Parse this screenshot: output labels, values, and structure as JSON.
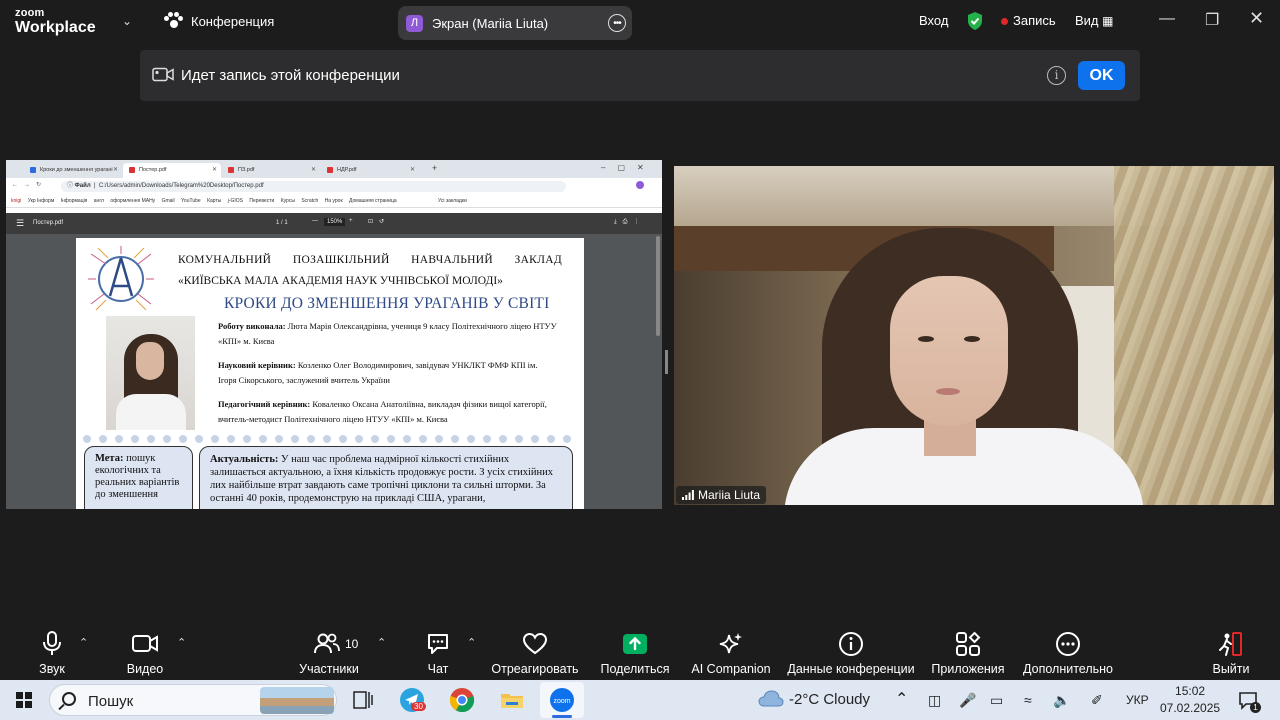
{
  "app": {
    "logo_line1": "zoom",
    "logo_line2": "Workplace",
    "conference_label": "Конференция",
    "share_pill": {
      "avatar_letter": "Л",
      "label": "Экран (Mariia Liuta)"
    },
    "signin_label": "Вход",
    "record_label": "Запись",
    "view_label": "Вид"
  },
  "banner": {
    "text": "Идет запись этой конференции",
    "ok_label": "OK"
  },
  "shared_screen": {
    "tabs": [
      "Кроки до зменшення урагані",
      "Постер.pdf",
      "ПЗ.pdf",
      "НДР.pdf"
    ],
    "address": "C:/Users/admin/Downloads/Telegram%20Desktop/Постер.pdf",
    "address_prefix": "Файл",
    "bookmarks": [
      "knigi",
      "Укр Інформ",
      "Інформація",
      "англ",
      "оформлення МАНу",
      "Gmail",
      "YouTube",
      "Карты",
      "j-GIOS",
      "Перевести",
      "Курсы",
      "Scratch",
      "На урок",
      "Домашняя страница",
      "Усі закладки"
    ],
    "pdf_name": "Постер.pdf",
    "pdf_page": "1 / 1",
    "pdf_zoom": "150%",
    "poster": {
      "header1": "КОМУНАЛЬНИЙ ПОЗАШКІЛЬНИЙ НАВЧАЛЬНИЙ ЗАКЛАД",
      "header2": "«КИЇВСЬКА МАЛА АКАДЕМІЯ НАУК УЧНІВСЬКОЇ МОЛОДІ»",
      "title": "КРОКИ ДО ЗМЕНШЕННЯ УРАГАНІВ У СВІТІ",
      "author_label": "Роботу виконала:",
      "author_text": "Люта Марія Олександрівна, учениця 9 класу Політехнічного ліцею НТУУ «КПІ» м. Києва",
      "sci_label": "Науковий керівник:",
      "sci_text": "Козленко Олег Володимирович, завідувач УНКЛКТ ФМФ КПІ ім. Ігоря Сікорського, заслужений вчитель України",
      "ped_label": "Педагогічний керівник:",
      "ped_text": "Коваленко Оксана Анатоліївна, викладач фізики вищої категорії, вчитель-методист Політехнічного ліцею НТУУ «КПІ» м. Києва",
      "goal_label": "Мета:",
      "goal_text": "пошук екологічних та реальних варіантів до зменшення",
      "rel_label": "Актуальність:",
      "rel_text": "У наш час проблема надмірної кількості стихійних залишається актуальною, а їхня кількість продовжує рости. З усіх стихійних лих найбільше втрат завдають саме тропічні циклони та сильні шторми. За останні 40 років, продемонструю на прикладі США, урагани,"
    }
  },
  "video": {
    "participant_name": "Mariia Liuta"
  },
  "toolbar": {
    "audio": "Звук",
    "video": "Видео",
    "participants": "Участники",
    "participants_count": "10",
    "chat": "Чат",
    "react": "Отреагировать",
    "share": "Поделиться",
    "ai": "AI Companion",
    "info": "Данные конференции",
    "apps": "Приложения",
    "more": "Дополнительно",
    "leave": "Выйти"
  },
  "taskbar": {
    "search_placeholder": "Пошук",
    "telegram_badge": "30",
    "weather": "-2°C  Cloudy",
    "language": "УКР",
    "time": "15:02",
    "date": "07.02.2025",
    "notif_count": "1"
  },
  "colors": {
    "accent": "#0e72ed",
    "share_green": "#00b060",
    "record_red": "#e02828",
    "poster_title": "#2e4a86"
  }
}
